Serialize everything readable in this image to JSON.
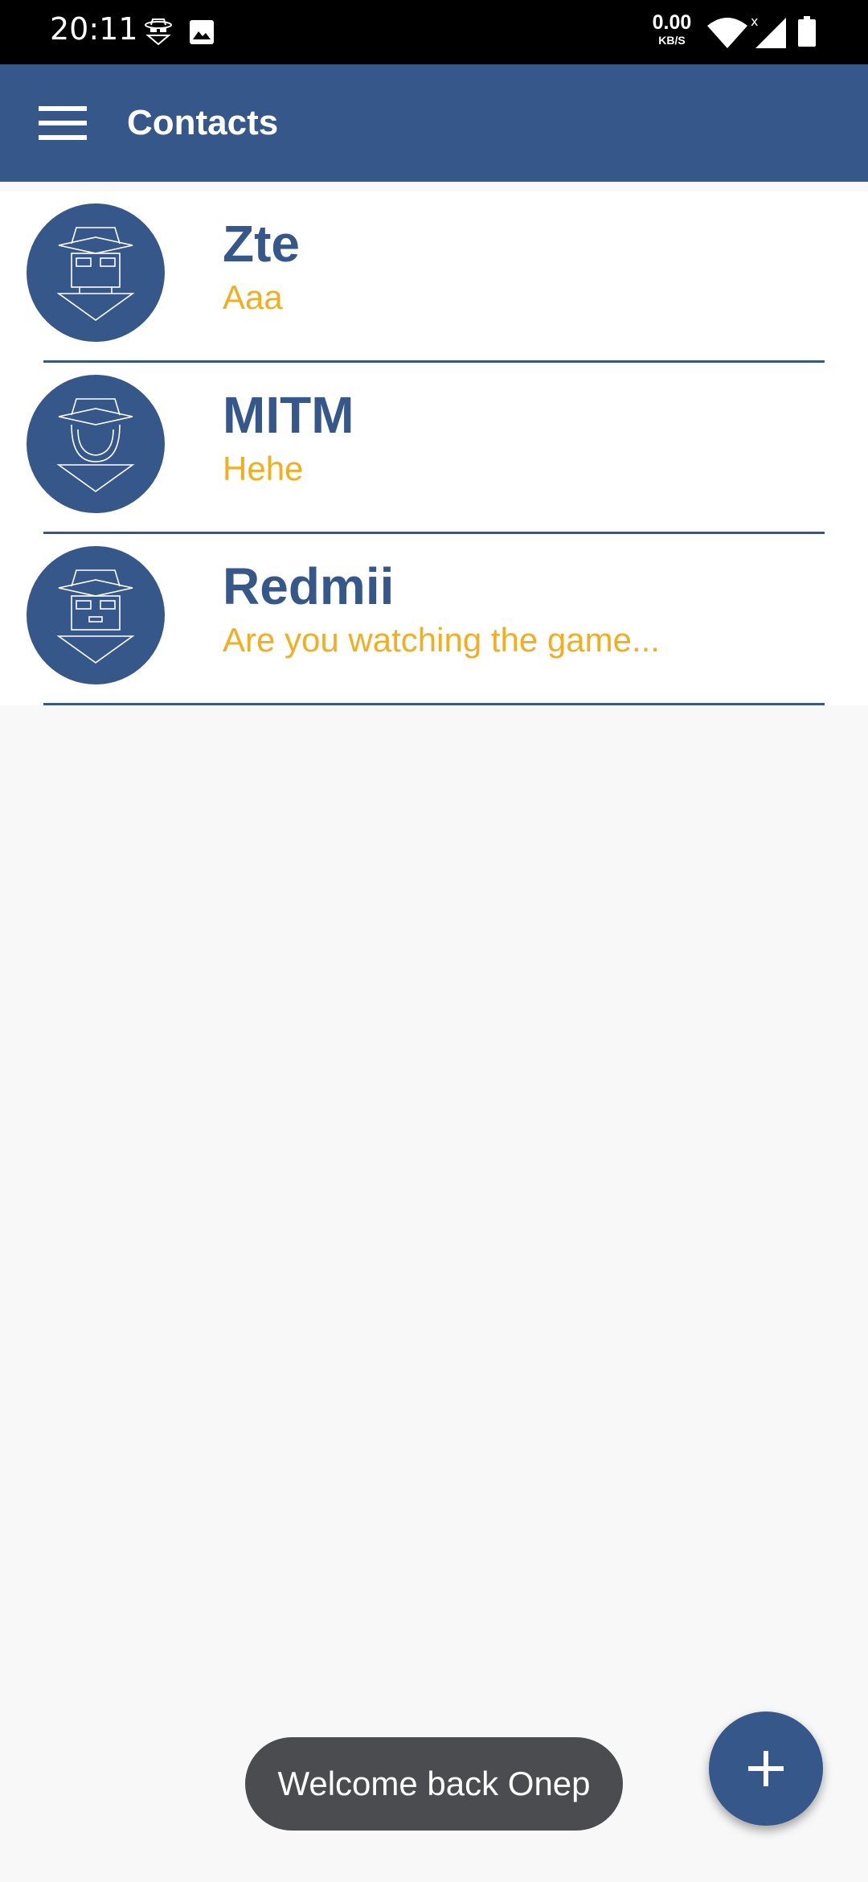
{
  "status_bar": {
    "time": "20:11",
    "speed_value": "0.00",
    "speed_unit": "KB/S",
    "app_icon": "spy-icon",
    "image_icon": "image-icon",
    "wifi_icon": "wifi-icon",
    "signal_icon": "signal-icon",
    "battery_icon": "battery-icon"
  },
  "app_bar": {
    "title": "Contacts",
    "menu_icon": "menu-icon",
    "background": "#36578a"
  },
  "contacts": [
    {
      "name": "Zte",
      "last_message": "Aaa",
      "avatar": "spy-avatar-icon"
    },
    {
      "name": "MITM",
      "last_message": "Hehe",
      "avatar": "spy-avatar-icon"
    },
    {
      "name": "Redmii",
      "last_message": "Are you watching the game...",
      "avatar": "spy-avatar-icon"
    }
  ],
  "toast": {
    "text": "Welcome back Onep"
  },
  "fab": {
    "icon": "plus-icon"
  },
  "colors": {
    "primary": "#36578a",
    "accent": "#f2ae21",
    "toast": "#4a4c50"
  }
}
